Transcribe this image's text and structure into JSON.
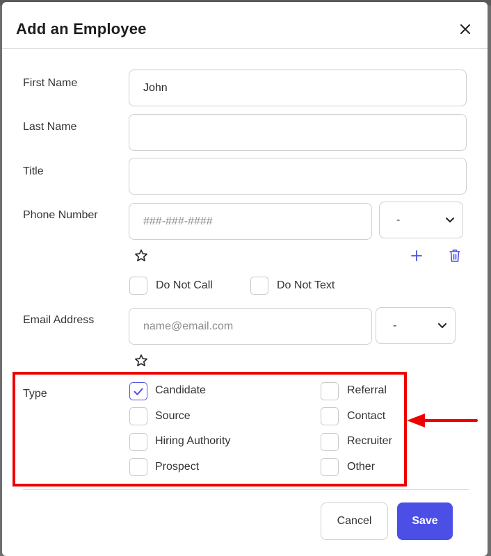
{
  "modal": {
    "title": "Add an Employee",
    "close_icon": "close-icon"
  },
  "fields": {
    "first_name": {
      "label": "First Name",
      "value": "John",
      "placeholder": ""
    },
    "last_name": {
      "label": "Last Name",
      "value": "",
      "placeholder": ""
    },
    "title": {
      "label": "Title",
      "value": "",
      "placeholder": ""
    },
    "phone": {
      "label": "Phone Number",
      "value": "",
      "placeholder": "###-###-####",
      "type_select": "-",
      "star_icon": "star-icon",
      "add_icon": "plus-icon",
      "delete_icon": "trash-icon",
      "options": [
        {
          "label": "Do Not Call",
          "checked": false
        },
        {
          "label": "Do Not Text",
          "checked": false
        }
      ]
    },
    "email": {
      "label": "Email Address",
      "value": "",
      "placeholder": "name@email.com",
      "type_select": "-",
      "star_icon": "star-icon"
    }
  },
  "type_section": {
    "label": "Type",
    "options": [
      {
        "label": "Candidate",
        "checked": true
      },
      {
        "label": "Referral",
        "checked": false
      },
      {
        "label": "Source",
        "checked": false
      },
      {
        "label": "Contact",
        "checked": false
      },
      {
        "label": "Hiring Authority",
        "checked": false
      },
      {
        "label": "Recruiter",
        "checked": false
      },
      {
        "label": "Prospect",
        "checked": false
      },
      {
        "label": "Other",
        "checked": false
      }
    ]
  },
  "footer": {
    "cancel_label": "Cancel",
    "save_label": "Save"
  },
  "colors": {
    "accent": "#4b4fe6",
    "highlight": "#ee0000"
  }
}
